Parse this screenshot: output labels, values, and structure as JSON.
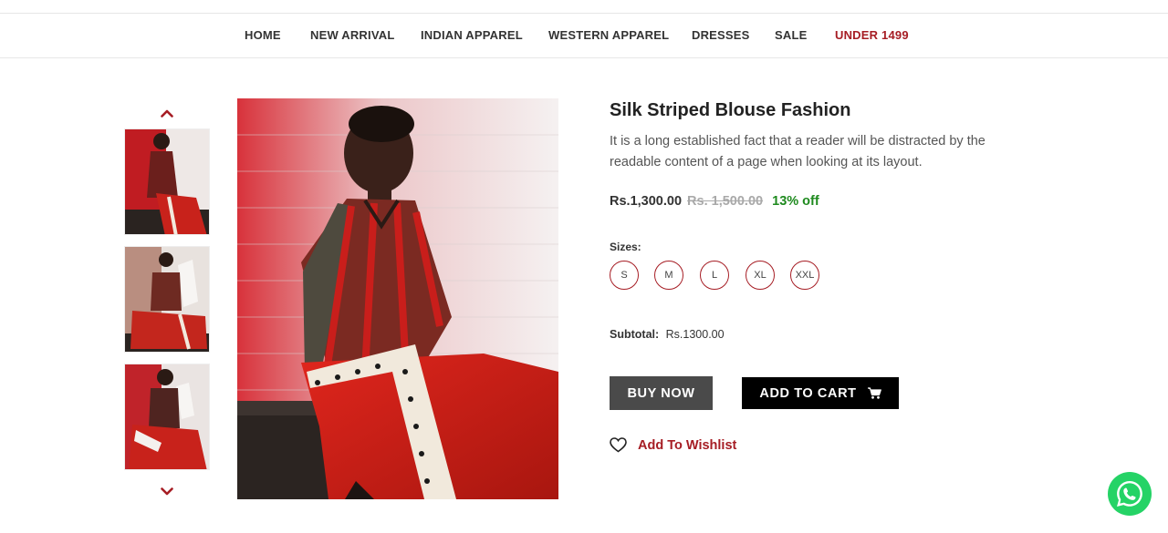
{
  "nav": {
    "items": [
      {
        "label": "HOME"
      },
      {
        "label": "NEW ARRIVAL"
      },
      {
        "label": "INDIAN APPAREL"
      },
      {
        "label": "WESTERN APPAREL"
      },
      {
        "label": "DRESSES"
      },
      {
        "label": "SALE"
      },
      {
        "label": "UNDER 1499"
      }
    ]
  },
  "gallery": {
    "up_icon": "chevron-up-icon",
    "down_icon": "chevron-down-icon",
    "accent_color": "#a61d24"
  },
  "product": {
    "title": "Silk Striped Blouse Fashion",
    "description": "It is a long established fact that a reader will be distracted by the readable content of a page when looking at its layout.",
    "price": "Rs.1,300.00",
    "old_price": "Rs. 1,500.00",
    "discount": "13% off",
    "sizes_label": "Sizes:",
    "sizes": [
      "S",
      "M",
      "L",
      "XL",
      "XXL"
    ],
    "subtotal_label": "Subtotal:",
    "subtotal_value": "Rs.1300.00",
    "buy_now_label": "BUY NOW",
    "add_to_cart_label": "ADD TO CART",
    "wishlist_label": "Add To Wishlist"
  },
  "colors": {
    "accent": "#a61d24",
    "discount": "#1e8a1e",
    "buy_button": "#4a4a4a",
    "cart_button": "#000000",
    "whatsapp": "#25d366"
  },
  "icons": {
    "cart": "cart-icon",
    "wishlist": "heart-icon",
    "chat": "whatsapp-icon"
  }
}
